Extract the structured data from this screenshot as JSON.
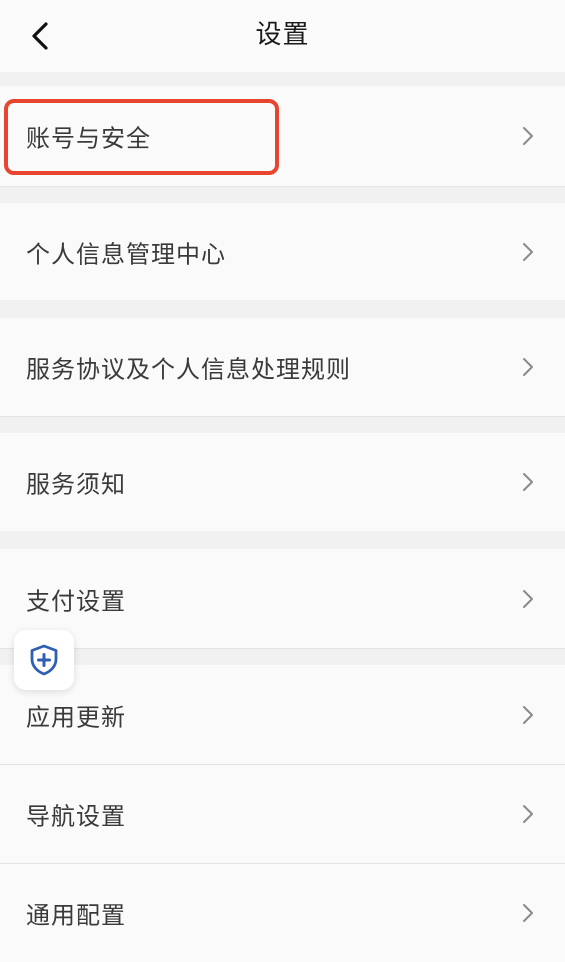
{
  "header": {
    "back_icon": "chevron-left-icon",
    "title": "设置"
  },
  "menu": {
    "items": [
      {
        "label": "账号与安全",
        "chevron_icon": "chevron-right-icon"
      },
      {
        "label": "个人信息管理中心",
        "chevron_icon": "chevron-right-icon"
      },
      {
        "label": "服务协议及个人信息处理规则",
        "chevron_icon": "chevron-right-icon"
      },
      {
        "label": "服务须知",
        "chevron_icon": "chevron-right-icon"
      },
      {
        "label": "支付设置",
        "chevron_icon": "chevron-right-icon"
      },
      {
        "label": "应用更新",
        "chevron_icon": "chevron-right-icon"
      },
      {
        "label": "导航设置",
        "chevron_icon": "chevron-right-icon"
      },
      {
        "label": "通用配置",
        "chevron_icon": "chevron-right-icon"
      }
    ]
  },
  "floating_button": {
    "icon": "shield-plus-icon"
  },
  "colors": {
    "highlight_border": "#e8452f",
    "shield_blue": "#2f5fb3",
    "chevron": "#8a8a8a"
  }
}
